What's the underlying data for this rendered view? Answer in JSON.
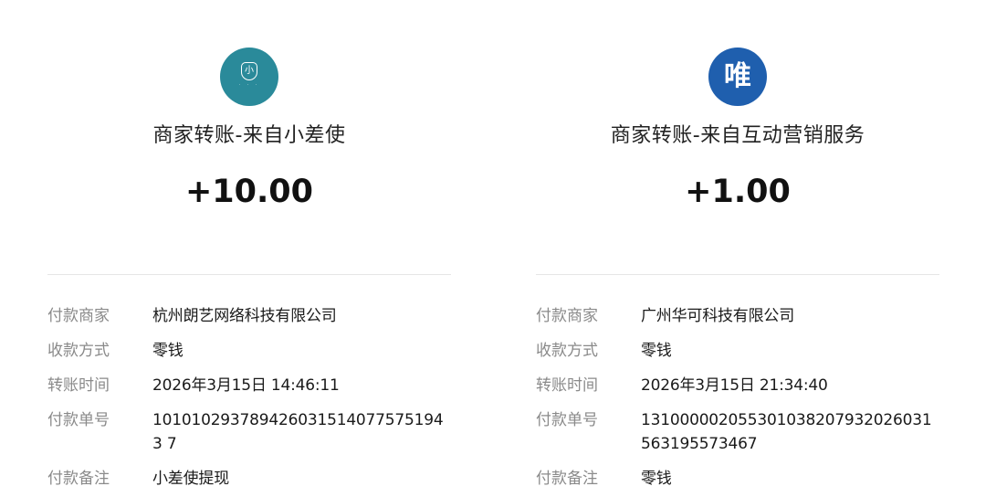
{
  "colors": {
    "left_avatar": "#2a8a9a",
    "right_avatar": "#1f5fae"
  },
  "left": {
    "avatar_icon": "xiaochaishi-logo-icon",
    "avatar_text": "小",
    "title": "商家转账-来自小差使",
    "amount": "+10.00",
    "rows": [
      {
        "label": "付款商家",
        "value": "杭州朗艺网络科技有限公司"
      },
      {
        "label": "收款方式",
        "value": "零钱"
      },
      {
        "label": "转账时间",
        "value": "2026年3月15日 14:46:11"
      },
      {
        "label": "付款单号",
        "value": "1010102937894260315140775751943 7"
      },
      {
        "label": "付款备注",
        "value": "小差使提现"
      }
    ]
  },
  "right": {
    "avatar_icon": "vip-logo-icon",
    "avatar_text": "唯",
    "title": "商家转账-来自互动营销服务",
    "amount": "+1.00",
    "rows": [
      {
        "label": "付款商家",
        "value": "广州华可科技有限公司"
      },
      {
        "label": "收款方式",
        "value": "零钱"
      },
      {
        "label": "转账时间",
        "value": "2026年3月15日 21:34:40"
      },
      {
        "label": "付款单号",
        "value": "131000002055301038207932026031563195573467"
      },
      {
        "label": "付款备注",
        "value": "零钱"
      }
    ]
  }
}
